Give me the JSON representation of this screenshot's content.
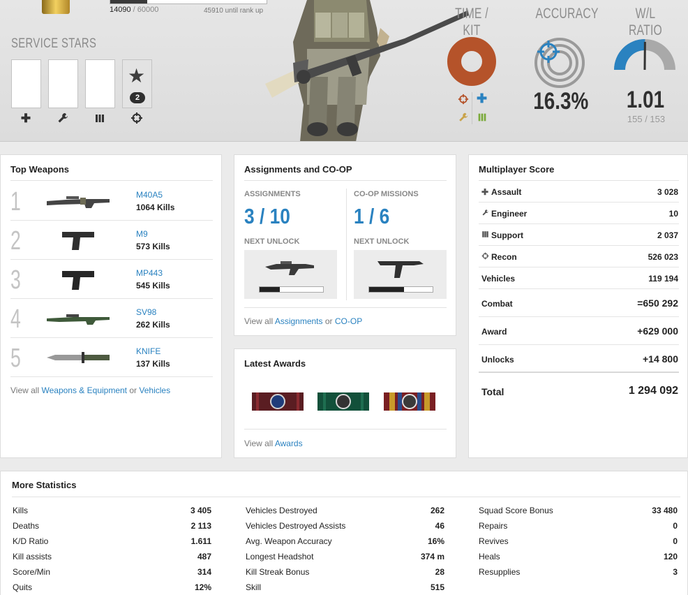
{
  "rank": {
    "xp_current": "14090",
    "xp_max": "/ 60000",
    "until_rank_up": "45910 until rank up",
    "progress_fraction": 0.235
  },
  "service_stars": {
    "title": "SERVICE STARS",
    "kits": [
      {
        "icon": "assault-plus-icon",
        "count": ""
      },
      {
        "icon": "engineer-wrench-icon",
        "count": ""
      },
      {
        "icon": "support-ammo-icon",
        "count": ""
      },
      {
        "icon": "recon-crosshair-icon",
        "count": "2"
      }
    ]
  },
  "summary": {
    "time_kit_title": "TIME / KIT",
    "accuracy_title": "ACCURACY",
    "accuracy_value": "16.3%",
    "wl_title": "W/L RATIO",
    "wl_value": "1.01",
    "wl_sub": "155 / 153",
    "wl_gauge_fraction": 0.503,
    "kit_colors": {
      "recon": "#b5532a",
      "assault": "#2a82c0",
      "engineer": "#c9a34a",
      "support": "#7aaa3a"
    }
  },
  "top_weapons": {
    "title": "Top Weapons",
    "items": [
      {
        "rank": "1",
        "name": "M40A5",
        "kills": "1064 Kills"
      },
      {
        "rank": "2",
        "name": "M9",
        "kills": "573 Kills"
      },
      {
        "rank": "3",
        "name": "MP443",
        "kills": "545 Kills"
      },
      {
        "rank": "4",
        "name": "SV98",
        "kills": "262 Kills"
      },
      {
        "rank": "5",
        "name": "KNIFE",
        "kills": "137 Kills"
      }
    ],
    "view_all_prefix": "View all",
    "link_weapons": "Weapons & Equipment",
    "or": "or",
    "link_vehicles": "Vehicles"
  },
  "assignments": {
    "title": "Assignments and CO-OP",
    "assign_label": "ASSIGNMENTS",
    "assign_value": "3 / 10",
    "coop_label": "CO-OP MISSIONS",
    "coop_value": "1 / 6",
    "next_unlock": "NEXT UNLOCK",
    "assign_unlock_progress": 0.32,
    "coop_unlock_progress": 0.55,
    "view_all_prefix": "View all",
    "link_assignments": "Assignments",
    "or": "or",
    "link_coop": "CO-OP"
  },
  "awards": {
    "title": "Latest Awards",
    "view_all_prefix": "View all",
    "link_awards": "Awards"
  },
  "mp_score": {
    "title": "Multiplayer Score",
    "rows": [
      {
        "label": "Assault",
        "value": "3 028",
        "icon": "assault-plus-icon"
      },
      {
        "label": "Engineer",
        "value": "10",
        "icon": "engineer-wrench-icon"
      },
      {
        "label": "Support",
        "value": "2 037",
        "icon": "support-ammo-icon"
      },
      {
        "label": "Recon",
        "value": "526 023",
        "icon": "recon-crosshair-icon"
      },
      {
        "label": "Vehicles",
        "value": "119 194"
      },
      {
        "label": "Combat",
        "value": "=650 292"
      },
      {
        "label": "Award",
        "value": "+629 000"
      },
      {
        "label": "Unlocks",
        "value": "+14 800"
      }
    ],
    "total_label": "Total",
    "total_value": "1 294 092"
  },
  "more_stats": {
    "title": "More Statistics",
    "col1": [
      {
        "label": "Kills",
        "value": "3 405"
      },
      {
        "label": "Deaths",
        "value": "2 113"
      },
      {
        "label": "K/D Ratio",
        "value": "1.611"
      },
      {
        "label": "Kill assists",
        "value": "487"
      },
      {
        "label": "Score/Min",
        "value": "314"
      },
      {
        "label": "Quits",
        "value": "12%"
      }
    ],
    "col2": [
      {
        "label": "Vehicles Destroyed",
        "value": "262"
      },
      {
        "label": "Vehicles Destroyed Assists",
        "value": "46"
      },
      {
        "label": "Avg. Weapon Accuracy",
        "value": "16%"
      },
      {
        "label": "Longest Headshot",
        "value": "374 m"
      },
      {
        "label": "Kill Streak Bonus",
        "value": "28"
      },
      {
        "label": "Skill",
        "value": "515"
      }
    ],
    "col3": [
      {
        "label": "Squad Score Bonus",
        "value": "33 480"
      },
      {
        "label": "Repairs",
        "value": "0"
      },
      {
        "label": "Revives",
        "value": "0"
      },
      {
        "label": "Heals",
        "value": "120"
      },
      {
        "label": "Resupplies",
        "value": "3"
      }
    ]
  }
}
